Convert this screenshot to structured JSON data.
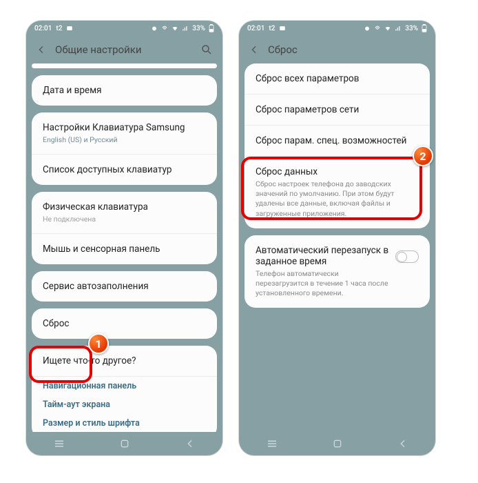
{
  "status": {
    "time": "02:01",
    "carrier": "t2",
    "battery": "33%"
  },
  "screen1": {
    "headerTitle": "Общие настройки",
    "rows": {
      "datetime": "Дата и время",
      "samsungKb": {
        "title": "Настройки Клавиатура Samsung",
        "sub": "English (US) и Русский"
      },
      "kbList": "Список доступных клавиатур",
      "physKb": {
        "title": "Физическая клавиатура",
        "sub": "Не подключена"
      },
      "mouse": "Мышь и сенсорная панель",
      "autofill": "Сервис автозаполнения",
      "reset": "Сброс",
      "lookingFor": "Ищете что-то другое?",
      "link1": "Навигационная панель",
      "link2": "Тайм-аут экрана",
      "link3": "Размер и стиль шрифта"
    },
    "badge": "1"
  },
  "screen2": {
    "headerTitle": "Сброс",
    "rows": {
      "r1": "Сброс всех параметров",
      "r2": "Сброс параметров сети",
      "r3": "Сброс парам. спец. возможностей",
      "r4": {
        "title": "Сброс данных",
        "desc": "Сброс настроек телефона до заводских значений по умолчанию. При этом будут удалены все данные, включая файлы и загруженные приложения."
      },
      "auto": {
        "title": "Автоматический перезапуск в заданное время",
        "desc": "Телефон автоматически перезагрузится в течение 1 часа после установленного времени."
      }
    },
    "badge": "2"
  }
}
